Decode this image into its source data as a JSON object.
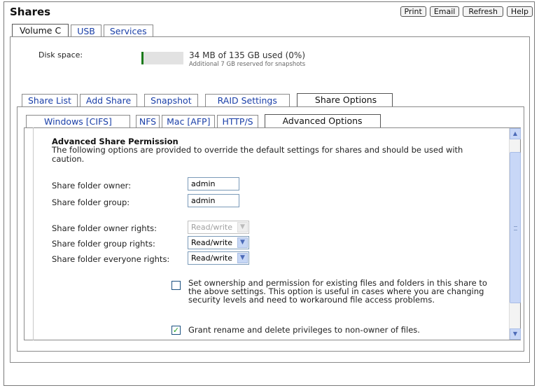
{
  "header": {
    "title": "Shares",
    "buttons": [
      "Print",
      "Email",
      "Refresh",
      "Help"
    ]
  },
  "volume_tabs": [
    {
      "label": "Volume C",
      "active": true
    },
    {
      "label": "USB",
      "active": false
    },
    {
      "label": "Services",
      "active": false
    }
  ],
  "disk": {
    "label": "Disk space:",
    "used_text": "34 MB of 135 GB used (0%)",
    "reserved_text": "Additional 7 GB reserved for snapshots",
    "used_percent": 0,
    "bar_color": "#1a7a1a"
  },
  "main_tabs": [
    {
      "label": "Share List",
      "active": false
    },
    {
      "label": "Add Share",
      "active": false
    },
    {
      "label": "Snapshot",
      "active": false
    },
    {
      "label": "RAID Settings",
      "active": false
    },
    {
      "label": "Share Options",
      "active": true
    }
  ],
  "sub_tabs": [
    {
      "label": "Windows [CIFS]",
      "active": false
    },
    {
      "label": "NFS",
      "active": false
    },
    {
      "label": "Mac [AFP]",
      "active": false
    },
    {
      "label": "HTTP/S",
      "active": false
    },
    {
      "label": "Advanced Options",
      "active": true
    }
  ],
  "advanced": {
    "heading": "Advanced Share Permission",
    "description": "The following options are provided to override the default settings for shares and should be used with caution.",
    "owner_label": "Share folder owner:",
    "owner_value": "admin",
    "group_label": "Share folder group:",
    "group_value": "admin",
    "owner_rights_label": "Share folder owner rights:",
    "owner_rights_value": "Read/write",
    "group_rights_label": "Share folder group rights:",
    "group_rights_value": "Read/write",
    "everyone_rights_label": "Share folder everyone rights:",
    "everyone_rights_value": "Read/write",
    "option1_text": "Set ownership and permission for existing files and folders in this share to the above settings. This option is useful in cases where you are changing security levels and need to workaround file access problems.",
    "option1_checked": false,
    "option2_text": "Grant rename and delete privileges to non-owner of files.",
    "option2_checked": true
  },
  "colors": {
    "tab_link": "#1a3fa8",
    "scroll_accent": "#c8d7f7",
    "checkmark": "#21a121"
  }
}
